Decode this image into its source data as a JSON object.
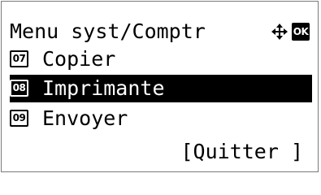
{
  "header": {
    "title": "Menu syst/Comptr",
    "ok_label": "OK",
    "nav_icon": "four-way-arrows-icon",
    "ok_icon": "ok-key-icon"
  },
  "menu": {
    "items": [
      {
        "number": "07",
        "label": "Copier",
        "selected": false
      },
      {
        "number": "08",
        "label": "Imprimante",
        "selected": true
      },
      {
        "number": "09",
        "label": "Envoyer",
        "selected": false
      }
    ]
  },
  "footer": {
    "quit_label": "[Quitter ]"
  },
  "colors": {
    "background": "#ffffff",
    "foreground": "#000000",
    "selection": "#000000"
  }
}
